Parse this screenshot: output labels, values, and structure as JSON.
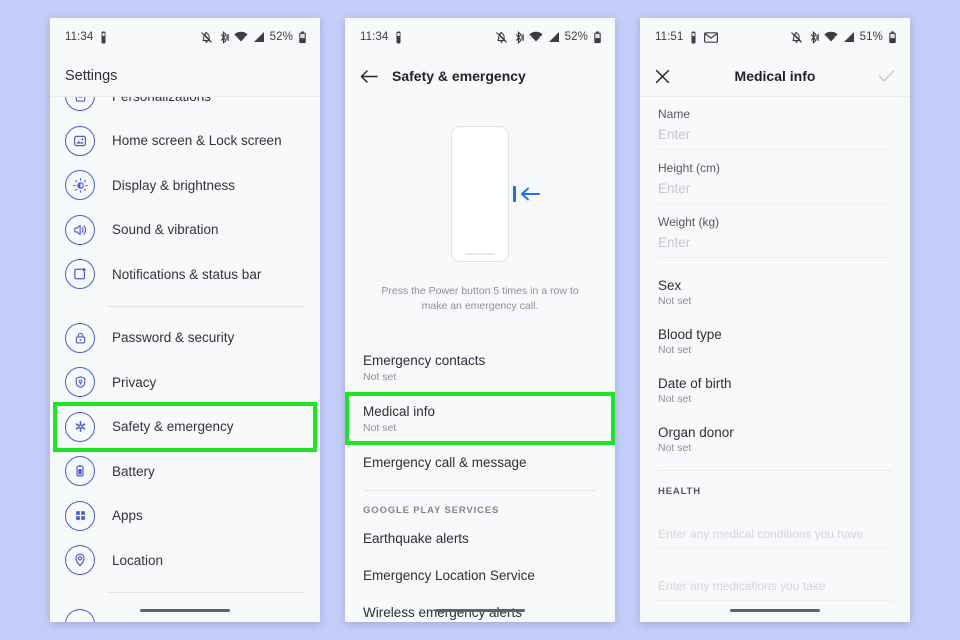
{
  "colors": {
    "page_background": "#c3cdf7",
    "panel_background": "#f8f9fb",
    "highlight_green": "#1ee524",
    "icon_blue": "#4b5dd1",
    "accent_blue": "#1a73e8"
  },
  "panel1": {
    "status_bar": {
      "time": "11:34",
      "battery_percent": "52%",
      "left_icons": [
        "vibrate-icon"
      ],
      "right_icons": [
        "bell-off-icon",
        "bluetooth-icon",
        "wifi-icon",
        "signal-icon",
        "battery-icon"
      ]
    },
    "app_bar": {
      "title": "Settings"
    },
    "items": [
      {
        "label": "Personalizations",
        "icon": "personalization-icon",
        "clipped": true
      },
      {
        "label": "Home screen & Lock screen",
        "icon": "home-lock-screen-icon"
      },
      {
        "label": "Display & brightness",
        "icon": "brightness-icon"
      },
      {
        "label": "Sound & vibration",
        "icon": "volume-icon"
      },
      {
        "label": "Notifications & status bar",
        "icon": "notification-icon"
      }
    ],
    "items2": [
      {
        "label": "Password & security",
        "icon": "lock-icon"
      },
      {
        "label": "Privacy",
        "icon": "shield-icon"
      },
      {
        "label": "Safety & emergency",
        "icon": "medical-star-icon",
        "highlighted": true
      },
      {
        "label": "Battery",
        "icon": "battery-icon"
      },
      {
        "label": "Apps",
        "icon": "apps-grid-icon"
      },
      {
        "label": "Location",
        "icon": "location-pin-icon"
      }
    ]
  },
  "panel2": {
    "status_bar": {
      "time": "11:34",
      "battery_percent": "52%"
    },
    "app_bar": {
      "title": "Safety & emergency",
      "back_icon": "back-arrow-icon"
    },
    "illustration": {
      "caption": "Press the Power button 5 times in a row to make an emergency call.",
      "power_button_icon": "power-button-indicator",
      "arrow_icon": "left-arrow-icon"
    },
    "options": [
      {
        "title": "Emergency contacts",
        "subtitle": "Not set"
      },
      {
        "title": "Medical info",
        "subtitle": "Not set",
        "highlighted": true
      },
      {
        "title": "Emergency call & message",
        "subtitle": ""
      }
    ],
    "section_header": "GOOGLE PLAY SERVICES",
    "section_items": [
      {
        "title": "Earthquake alerts"
      },
      {
        "title": "Emergency Location Service"
      },
      {
        "title": "Wireless emergency alerts"
      }
    ]
  },
  "panel3": {
    "status_bar": {
      "time": "11:51",
      "battery_percent": "51%",
      "left_icons": [
        "vibrate-icon",
        "gmail-icon"
      ]
    },
    "app_bar": {
      "title": "Medical info",
      "close_icon": "close-icon",
      "confirm_icon": "check-icon"
    },
    "fields": [
      {
        "label": "Name",
        "placeholder": "Enter",
        "value": ""
      },
      {
        "label": "Height (cm)",
        "placeholder": "Enter",
        "value": ""
      },
      {
        "label": "Weight (kg)",
        "placeholder": "Enter",
        "value": ""
      }
    ],
    "pickers": [
      {
        "title": "Sex",
        "value": "Not set"
      },
      {
        "title": "Blood type",
        "value": "Not set"
      },
      {
        "title": "Date of birth",
        "value": "Not set"
      },
      {
        "title": "Organ donor",
        "value": "Not set"
      }
    ],
    "health_header": "HEALTH",
    "textareas": [
      {
        "placeholder": "Enter any medical conditions you have"
      },
      {
        "placeholder": "Enter any medications you take"
      }
    ]
  }
}
